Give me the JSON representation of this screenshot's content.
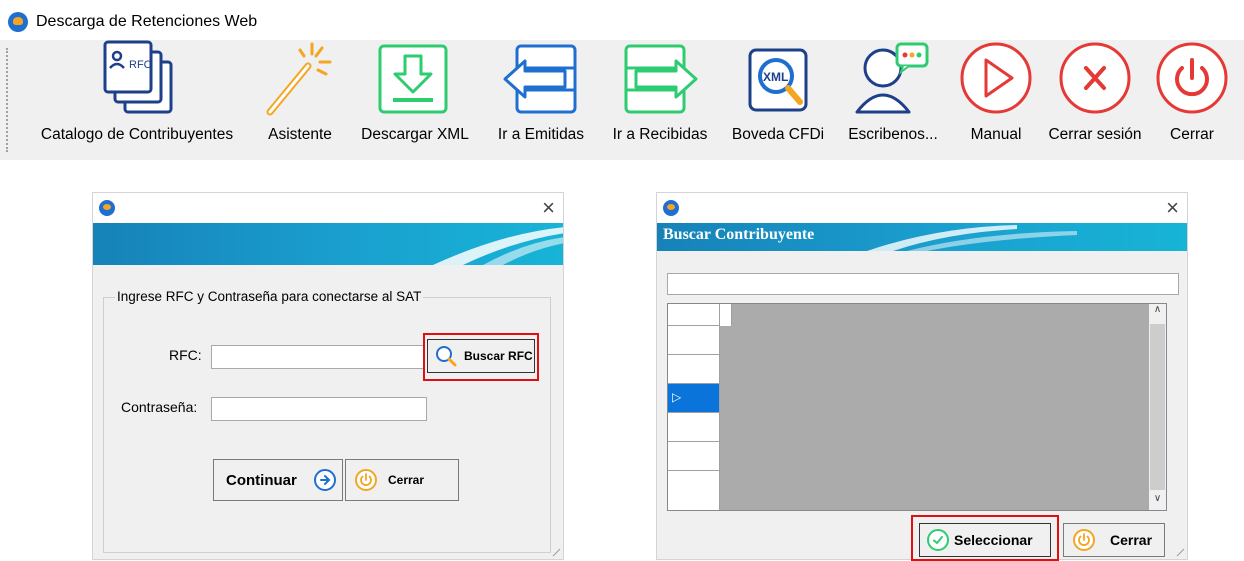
{
  "app": {
    "title": "Descarga de Retenciones Web"
  },
  "toolbar": {
    "items": [
      {
        "label": "Catalogo de Contribuyentes",
        "icon": "rfc-documents-icon"
      },
      {
        "label": "Asistente",
        "icon": "magic-wand-icon"
      },
      {
        "label": "Descargar XML",
        "icon": "download-icon"
      },
      {
        "label": "Ir a Emitidas",
        "icon": "arrow-left-icon"
      },
      {
        "label": "Ir a Recibidas",
        "icon": "arrow-right-icon"
      },
      {
        "label": "Boveda CFDi",
        "icon": "xml-search-icon"
      },
      {
        "label": "Escribenos...",
        "icon": "chat-person-icon"
      },
      {
        "label": "Manual",
        "icon": "play-icon"
      },
      {
        "label": "Cerrar sesión",
        "icon": "logout-x-icon"
      },
      {
        "label": "Cerrar",
        "icon": "power-icon"
      }
    ],
    "rfc_icon_text": "RFC",
    "xml_icon_text": "XML"
  },
  "login_dialog": {
    "close": "×",
    "group_title": "Ingrese RFC y Contraseña para conectarse al SAT",
    "rfc_label": "RFC:",
    "rfc_value": "",
    "buscar_rfc": "Buscar RFC",
    "password_label": "Contraseña:",
    "password_value": "",
    "continuar": "Continuar",
    "cerrar": "Cerrar"
  },
  "search_dialog": {
    "close": "×",
    "title": "Buscar Contribuyente",
    "search_value": "",
    "seleccionar": "Seleccionar",
    "cerrar": "Cerrar"
  },
  "colors": {
    "blue": "#1f6fd1",
    "orange": "#f4a623",
    "green": "#2ecc71",
    "red": "#e53935",
    "banner": "#1a9dcc",
    "highlight": "#e01010"
  }
}
